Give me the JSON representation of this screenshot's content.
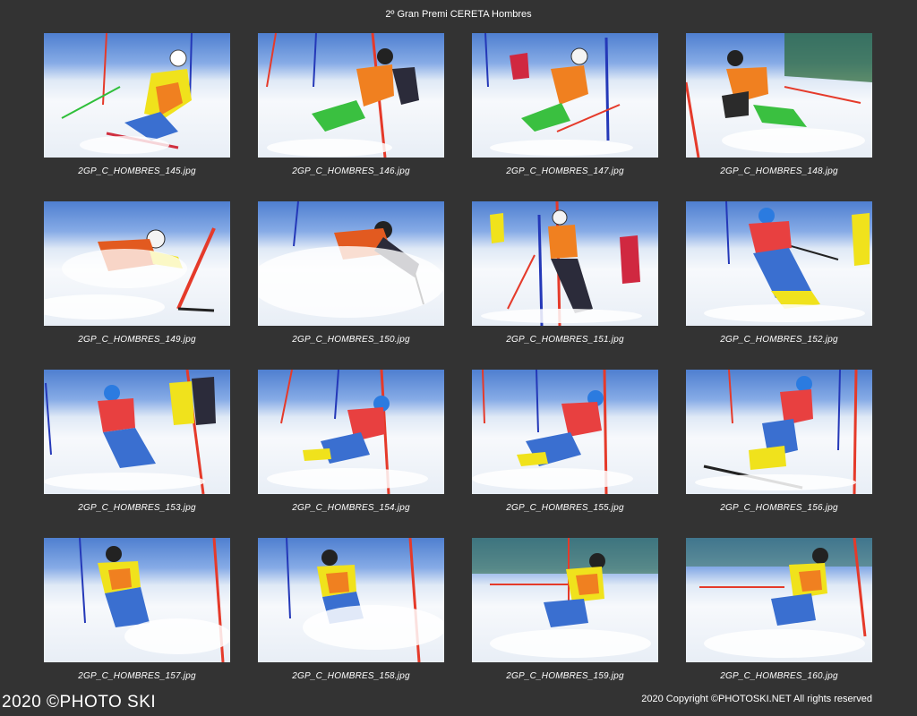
{
  "page": {
    "title": "2º Gran Premi CERETA Hombres",
    "footer_left": "2020 ©PHOTO SKI",
    "footer_right": "2020 Copyright ©PHOTOSKI.NET All rights reserved"
  },
  "thumbnails": [
    {
      "filename": "2GP_C_HOMBRES_145.jpg"
    },
    {
      "filename": "2GP_C_HOMBRES_146.jpg"
    },
    {
      "filename": "2GP_C_HOMBRES_147.jpg"
    },
    {
      "filename": "2GP_C_HOMBRES_148.jpg"
    },
    {
      "filename": "2GP_C_HOMBRES_149.jpg"
    },
    {
      "filename": "2GP_C_HOMBRES_150.jpg"
    },
    {
      "filename": "2GP_C_HOMBRES_151.jpg"
    },
    {
      "filename": "2GP_C_HOMBRES_152.jpg"
    },
    {
      "filename": "2GP_C_HOMBRES_153.jpg"
    },
    {
      "filename": "2GP_C_HOMBRES_154.jpg"
    },
    {
      "filename": "2GP_C_HOMBRES_155.jpg"
    },
    {
      "filename": "2GP_C_HOMBRES_156.jpg"
    },
    {
      "filename": "2GP_C_HOMBRES_157.jpg"
    },
    {
      "filename": "2GP_C_HOMBRES_158.jpg"
    },
    {
      "filename": "2GP_C_HOMBRES_159.jpg"
    },
    {
      "filename": "2GP_C_HOMBRES_160.jpg"
    }
  ],
  "colors": {
    "background": "#333333",
    "gate_red": "#e53a2a",
    "gate_blue": "#2438b8"
  }
}
